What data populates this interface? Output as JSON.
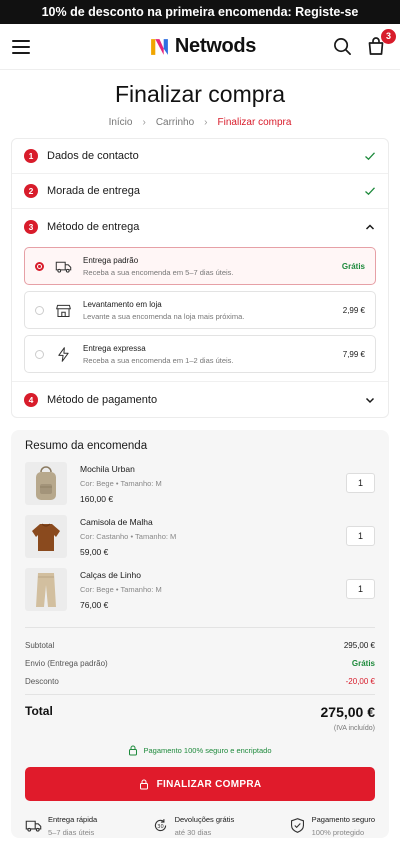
{
  "promo": {
    "text": "10% de desconto na primeira encomenda: Registe-se"
  },
  "header": {
    "brand": "Netwods",
    "cart_count": "3"
  },
  "page": {
    "title": "Finalizar compra",
    "breadcrumb": [
      "Início",
      "Carrinho",
      "Finalizar compra"
    ]
  },
  "steps": [
    {
      "num": "1",
      "label": "Dados de contacto",
      "state": "done"
    },
    {
      "num": "2",
      "label": "Morada de entrega",
      "state": "done"
    },
    {
      "num": "3",
      "label": "Método de entrega",
      "state": "open"
    },
    {
      "num": "4",
      "label": "Método de pagamento",
      "state": "collapsed"
    }
  ],
  "delivery_options": [
    {
      "title": "Entrega padrão",
      "desc": "Receba a sua encomenda em 5–7 dias úteis.",
      "price": "Grátis",
      "icon": "truck-icon",
      "selected": true
    },
    {
      "title": "Levantamento em loja",
      "desc": "Levante a sua encomenda na loja mais próxima.",
      "price": "2,99 €",
      "icon": "store-icon",
      "selected": false
    },
    {
      "title": "Entrega expressa",
      "desc": "Receba a sua encomenda em 1–2 dias úteis.",
      "price": "7,99 €",
      "icon": "lightning-icon",
      "selected": false
    }
  ],
  "summary": {
    "title": "Resumo da encomenda",
    "items": [
      {
        "name": "Mochila Urban",
        "color": "Cor: Bege",
        "size": "Tamanho: M",
        "price": "160,00 €",
        "qty": "1"
      },
      {
        "name": "Camisola de Malha",
        "color": "Cor: Castanho",
        "size": "Tamanho: M",
        "price": "59,00 €",
        "qty": "1"
      },
      {
        "name": "Calças de Linho",
        "color": "Cor: Bege",
        "size": "Tamanho: M",
        "price": "76,00 €",
        "qty": "1"
      }
    ],
    "subtotal_label": "Subtotal",
    "subtotal": "295,00 €",
    "shipping_label": "Envio (Entrega padrão)",
    "shipping": "Grátis",
    "discount_label": "Desconto",
    "discount": "-20,00 €",
    "total_label": "Total",
    "total": "275,00 €",
    "iva": "(IVA incluído)",
    "secure": "Pagamento 100% seguro e encriptado",
    "cta": "FINALIZAR COMPRA"
  },
  "features": [
    {
      "title": "Entrega rápida",
      "sub": "5–7 dias úteis"
    },
    {
      "title": "Devoluções grátis",
      "sub": "até 30 dias"
    },
    {
      "title": "Pagamento seguro",
      "sub": "100% protegido"
    }
  ],
  "colors": {
    "accent": "#d81c2b",
    "success": "#1e8a3c"
  }
}
